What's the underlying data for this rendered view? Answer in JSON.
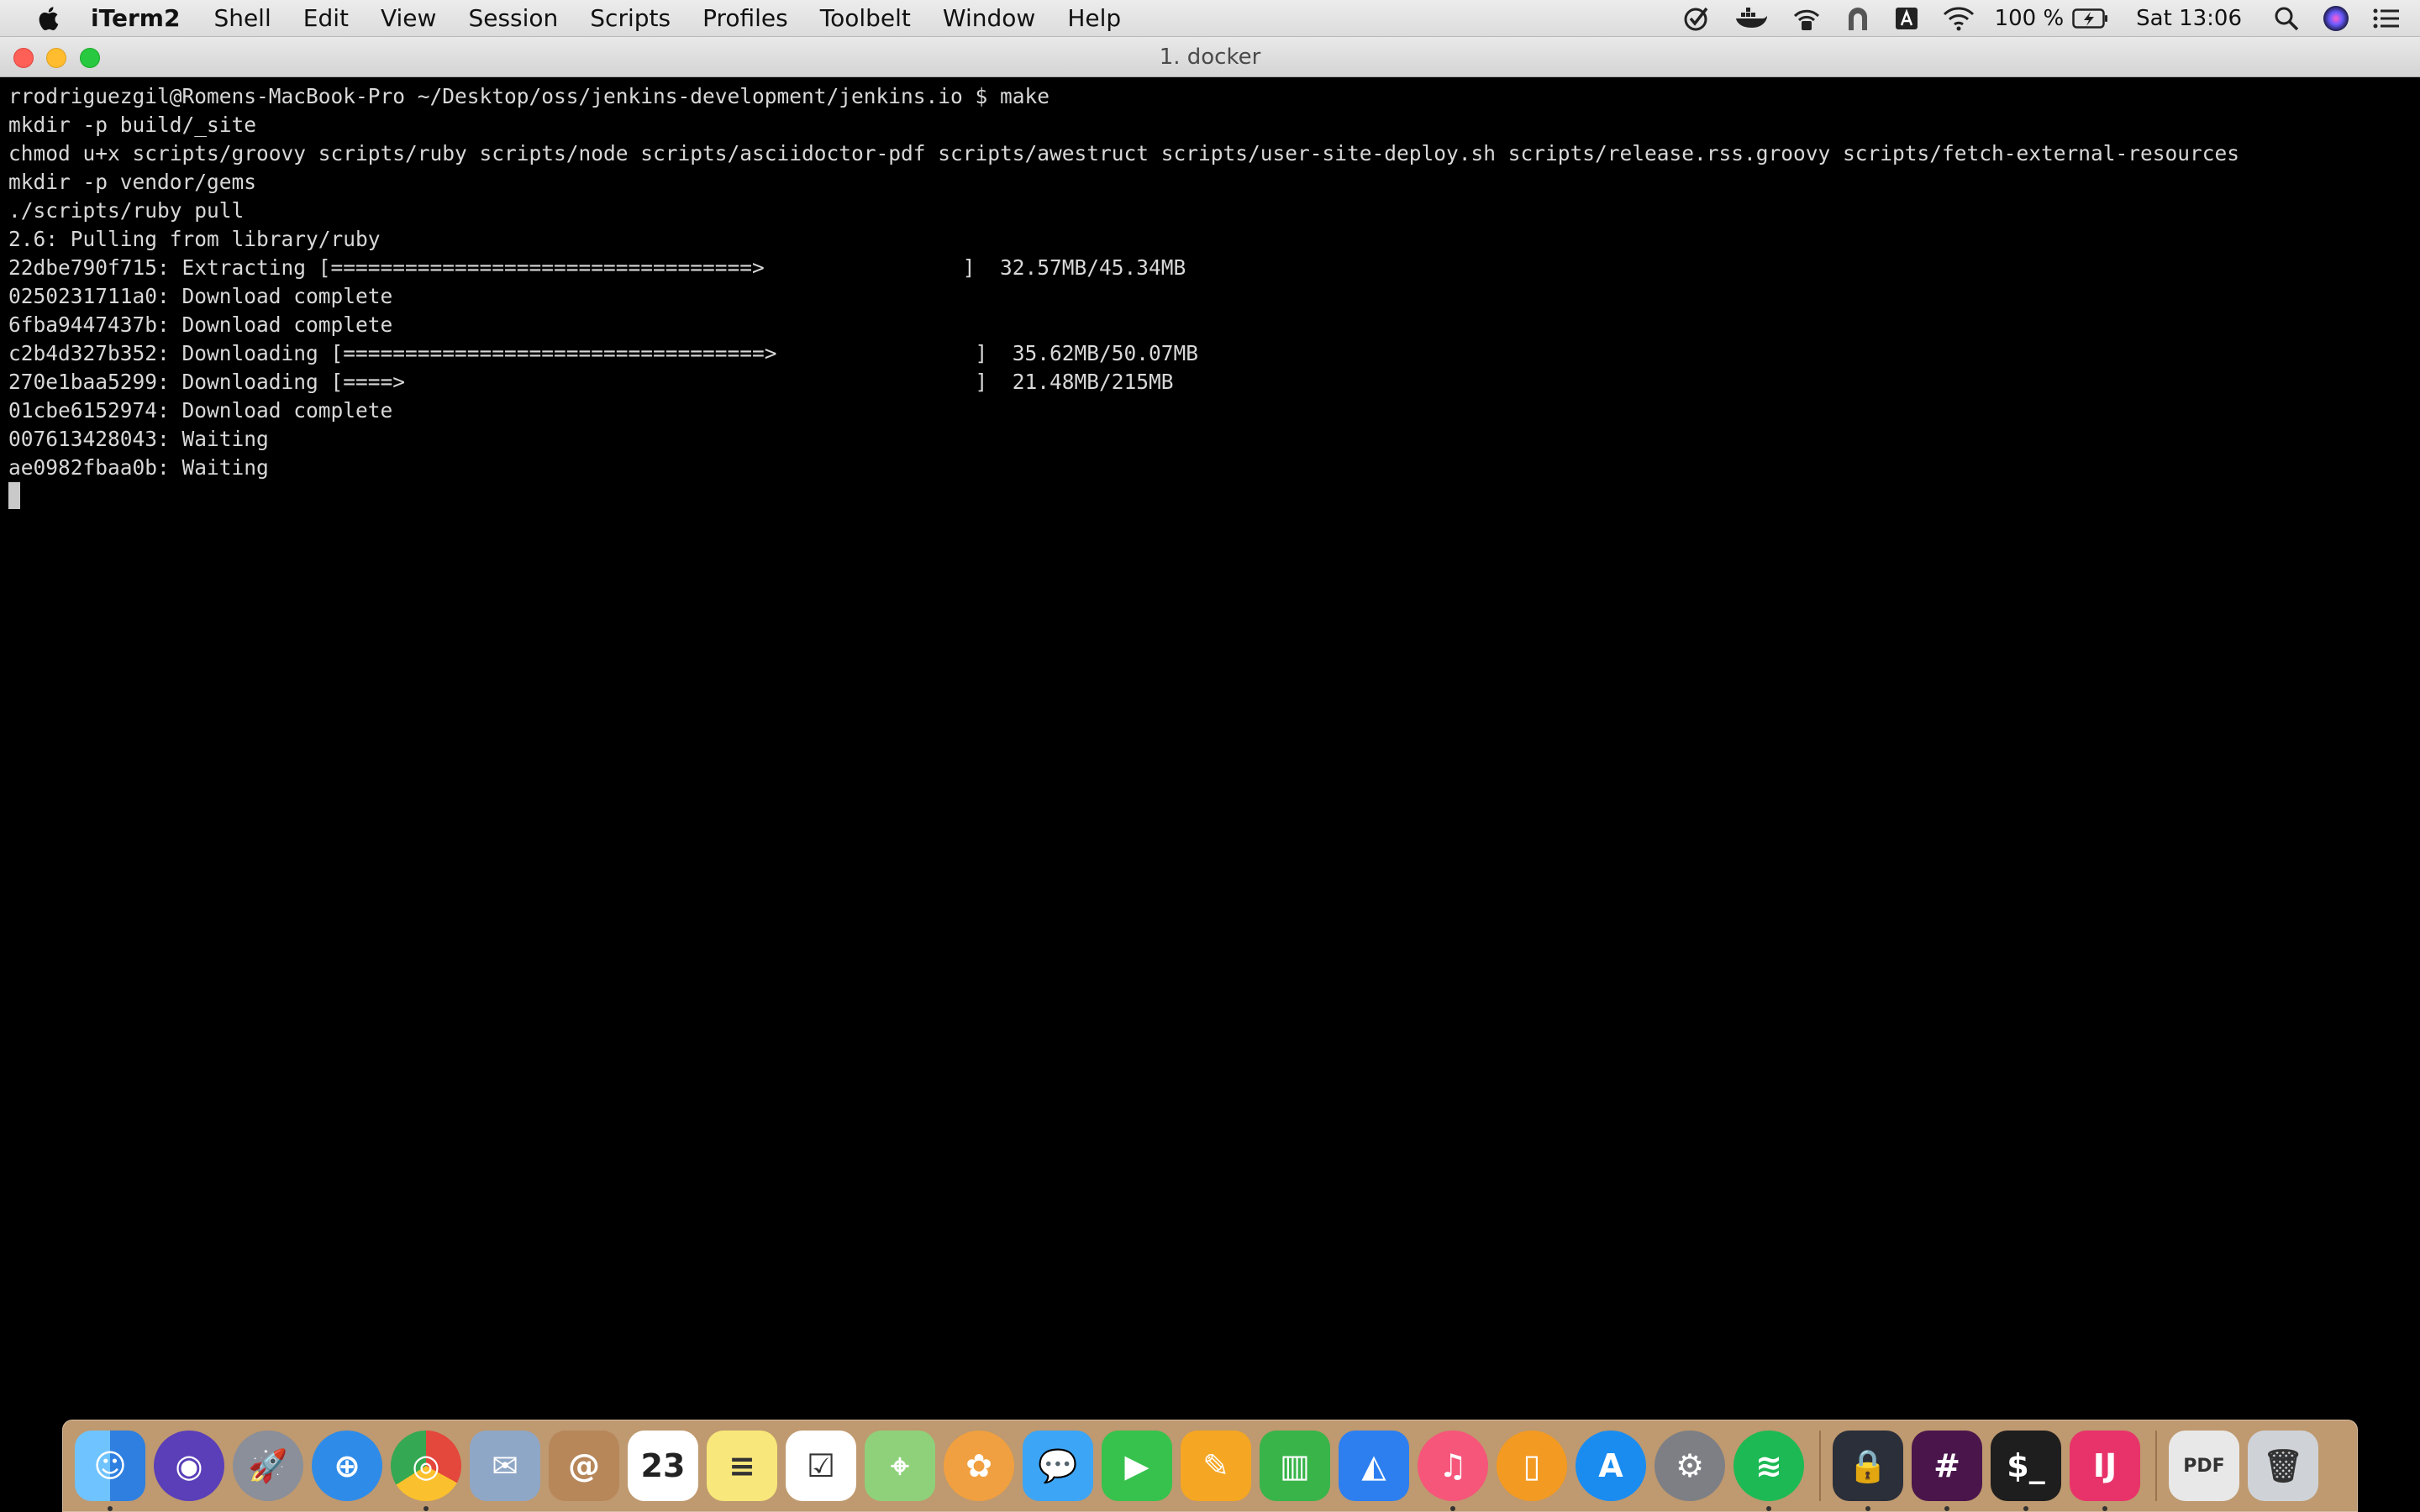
{
  "menubar": {
    "apple_icon": "apple-logo-icon",
    "app_name": "iTerm2",
    "items": [
      "Shell",
      "Edit",
      "View",
      "Session",
      "Scripts",
      "Profiles",
      "Toolbelt",
      "Window",
      "Help"
    ],
    "status": {
      "battery_percent": "100 %",
      "clock": "Sat 13:06",
      "icons": [
        "checkmark-circle-icon",
        "docker-whale-icon",
        "wifi-lock-icon",
        "tunnel-icon",
        "monitor-a-icon",
        "wifi-icon",
        "battery-charging-icon",
        "search-icon",
        "siri-icon",
        "list-icon"
      ]
    }
  },
  "window": {
    "title": "1. docker"
  },
  "terminal": {
    "lines": [
      "rrodriguezgil@Romens-MacBook-Pro ~/Desktop/oss/jenkins-development/jenkins.io $ make",
      "mkdir -p build/_site",
      "chmod u+x scripts/groovy scripts/ruby scripts/node scripts/asciidoctor-pdf scripts/awestruct scripts/user-site-deploy.sh scripts/release.rss.groovy scripts/fetch-external-resources",
      "mkdir -p vendor/gems",
      "./scripts/ruby pull",
      "2.6: Pulling from library/ruby",
      "22dbe790f715: Extracting [==================================>                ]  32.57MB/45.34MB",
      "0250231711a0: Download complete",
      "6fba9447437b: Download complete",
      "c2b4d327b352: Downloading [==================================>                ]  35.62MB/50.07MB",
      "270e1baa5299: Downloading [====>                                              ]  21.48MB/215MB",
      "01cbe6152974: Download complete",
      "007613428043: Waiting",
      "ae0982fbaa0b: Waiting"
    ]
  },
  "dock": {
    "apps": [
      {
        "name": "finder-icon",
        "color": "#3b9cf0",
        "glyph": "☺",
        "running": true
      },
      {
        "name": "siri-icon",
        "color": "#5a3fb8",
        "glyph": "◉",
        "running": false
      },
      {
        "name": "launchpad-icon",
        "color": "#8a8f99",
        "glyph": "🚀",
        "running": false
      },
      {
        "name": "safari-icon",
        "color": "#2f8be8",
        "glyph": "⊕",
        "running": false
      },
      {
        "name": "chrome-icon",
        "color": "#e4473b",
        "glyph": "◎",
        "running": true
      },
      {
        "name": "mail-stamp-icon",
        "color": "#8fa7c6",
        "glyph": "✉",
        "running": false
      },
      {
        "name": "contacts-icon",
        "color": "#b7875a",
        "glyph": "@",
        "running": false
      },
      {
        "name": "calendar-icon",
        "color": "#ffffff",
        "glyph": "23",
        "running": false
      },
      {
        "name": "notes-icon",
        "color": "#f8e77a",
        "glyph": "≡",
        "running": false
      },
      {
        "name": "reminders-icon",
        "color": "#ffffff",
        "glyph": "☑",
        "running": false
      },
      {
        "name": "maps-icon",
        "color": "#8fd17a",
        "glyph": "⌖",
        "running": false
      },
      {
        "name": "photos-icon",
        "color": "#f0a040",
        "glyph": "✿",
        "running": false
      },
      {
        "name": "messages-icon",
        "color": "#3da5f5",
        "glyph": "💬",
        "running": false
      },
      {
        "name": "facetime-icon",
        "color": "#37c24d",
        "glyph": "▶",
        "running": false
      },
      {
        "name": "pages-icon",
        "color": "#f5a623",
        "glyph": "✎",
        "running": false
      },
      {
        "name": "numbers-icon",
        "color": "#38b449",
        "glyph": "▥",
        "running": false
      },
      {
        "name": "keynote-icon",
        "color": "#2d7ff0",
        "glyph": "◭",
        "running": false
      },
      {
        "name": "itunes-icon",
        "color": "#f5567a",
        "glyph": "♫",
        "running": true
      },
      {
        "name": "books-icon",
        "color": "#f39a22",
        "glyph": "▯",
        "running": false
      },
      {
        "name": "app-store-icon",
        "color": "#1a8cf0",
        "glyph": "A",
        "running": false
      },
      {
        "name": "system-preferences-icon",
        "color": "#7d7f85",
        "glyph": "⚙",
        "running": false
      },
      {
        "name": "spotify-icon",
        "color": "#1db954",
        "glyph": "≋",
        "running": true
      },
      {
        "name": "wifi-lock-app-icon",
        "color": "#2a2f3a",
        "glyph": "🔒",
        "running": true
      },
      {
        "name": "slack-icon",
        "color": "#4a154b",
        "glyph": "#",
        "running": true
      },
      {
        "name": "terminal-icon",
        "color": "#1e1e1e",
        "glyph": "$_",
        "running": true
      },
      {
        "name": "intellij-icon",
        "color": "#e8336a",
        "glyph": "IJ",
        "running": true
      }
    ],
    "trailing": [
      {
        "name": "documents-stack-icon",
        "color": "#e8e8e8",
        "glyph": "PDF"
      },
      {
        "name": "trash-icon",
        "color": "#cfd3d8",
        "glyph": "🗑"
      }
    ]
  }
}
